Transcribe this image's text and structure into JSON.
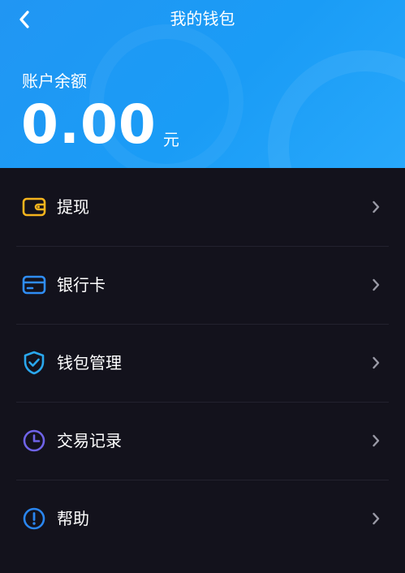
{
  "nav": {
    "title": "我的钱包"
  },
  "balance": {
    "label": "账户余额",
    "amount": "0.00",
    "unit": "元"
  },
  "menu": {
    "items": [
      {
        "label": "提现",
        "icon": "wallet-icon",
        "color": "#f5b41d"
      },
      {
        "label": "银行卡",
        "icon": "bank-card-icon",
        "color": "#2f8df5"
      },
      {
        "label": "钱包管理",
        "icon": "shield-check-icon",
        "color": "#2aa8ee"
      },
      {
        "label": "交易记录",
        "icon": "clock-icon",
        "color": "#6f63e8"
      },
      {
        "label": "帮助",
        "icon": "info-icon",
        "color": "#2a86f0"
      }
    ]
  },
  "colors": {
    "header_start": "#2196f3",
    "header_end": "#28a8fb",
    "background": "#13121c",
    "divider": "#23222e",
    "chevron": "#9a9aa6"
  }
}
